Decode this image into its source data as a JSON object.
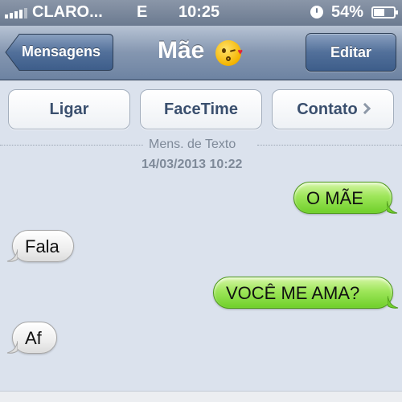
{
  "status_bar": {
    "carrier": "CLARO...",
    "network": "E",
    "time": "10:25",
    "battery": "54%",
    "icons": [
      "signal-icon",
      "alarm-icon",
      "battery-icon"
    ]
  },
  "nav": {
    "back_label": "Mensagens",
    "title": "Mãe",
    "title_emoji": "kissing-face-icon",
    "edit_label": "Editar"
  },
  "actions": {
    "call": "Ligar",
    "facetime": "FaceTime",
    "contact": "Contato"
  },
  "thread": {
    "type_label": "Mens. de Texto",
    "date": "14/03/2013 10:22"
  },
  "messages": [
    {
      "direction": "outgoing",
      "text": "O MÃE"
    },
    {
      "direction": "incoming",
      "text": "Fala"
    },
    {
      "direction": "outgoing",
      "text": "VOCÊ ME AMA?"
    },
    {
      "direction": "incoming",
      "text": "Af"
    }
  ],
  "colors": {
    "outgoing_bubble": "#8fdc48",
    "incoming_bubble": "#efefef",
    "background": "#dbe2ed",
    "nav_bar": "#6d83a2"
  }
}
